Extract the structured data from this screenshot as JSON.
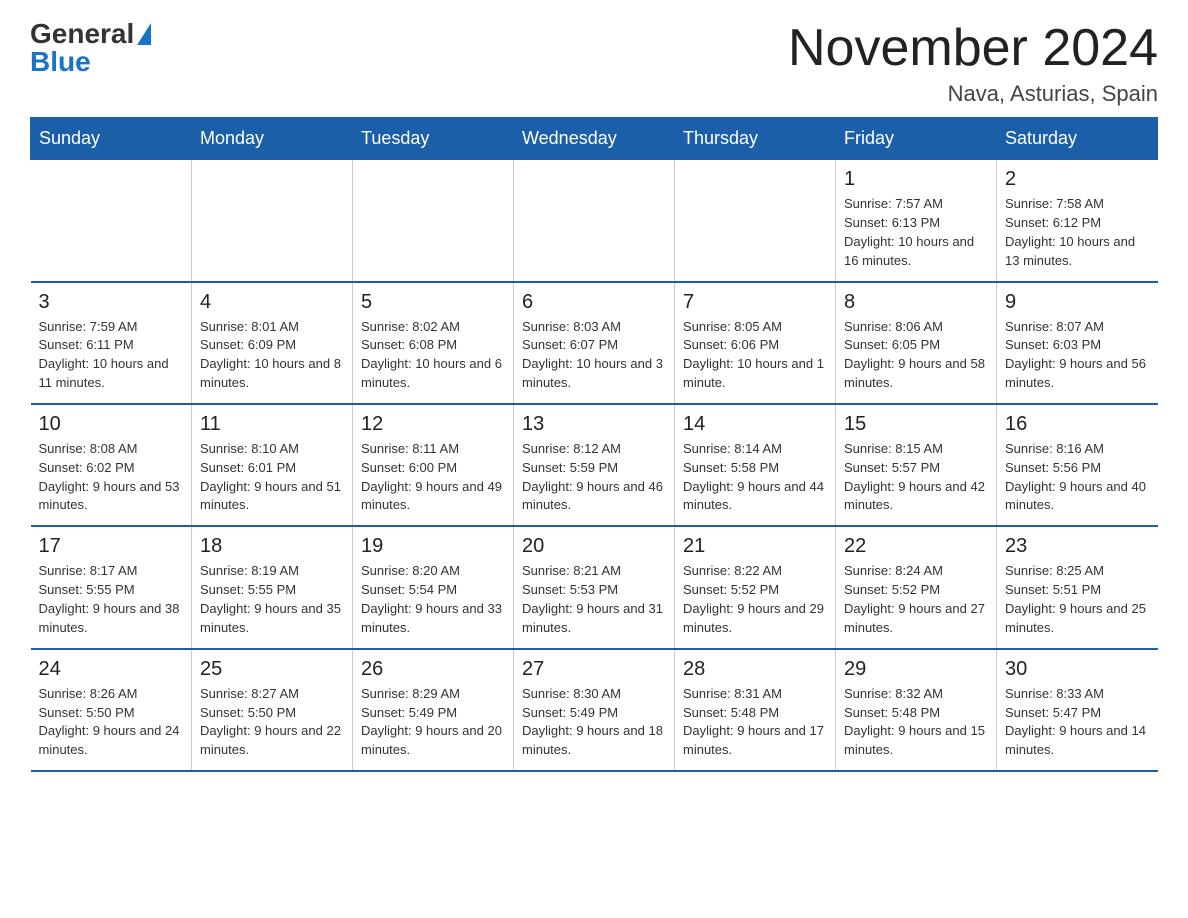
{
  "logo": {
    "general": "General",
    "blue": "Blue"
  },
  "header": {
    "title": "November 2024",
    "location": "Nava, Asturias, Spain"
  },
  "days_of_week": [
    "Sunday",
    "Monday",
    "Tuesday",
    "Wednesday",
    "Thursday",
    "Friday",
    "Saturday"
  ],
  "weeks": [
    [
      {
        "day": "",
        "info": ""
      },
      {
        "day": "",
        "info": ""
      },
      {
        "day": "",
        "info": ""
      },
      {
        "day": "",
        "info": ""
      },
      {
        "day": "",
        "info": ""
      },
      {
        "day": "1",
        "info": "Sunrise: 7:57 AM\nSunset: 6:13 PM\nDaylight: 10 hours and 16 minutes."
      },
      {
        "day": "2",
        "info": "Sunrise: 7:58 AM\nSunset: 6:12 PM\nDaylight: 10 hours and 13 minutes."
      }
    ],
    [
      {
        "day": "3",
        "info": "Sunrise: 7:59 AM\nSunset: 6:11 PM\nDaylight: 10 hours and 11 minutes."
      },
      {
        "day": "4",
        "info": "Sunrise: 8:01 AM\nSunset: 6:09 PM\nDaylight: 10 hours and 8 minutes."
      },
      {
        "day": "5",
        "info": "Sunrise: 8:02 AM\nSunset: 6:08 PM\nDaylight: 10 hours and 6 minutes."
      },
      {
        "day": "6",
        "info": "Sunrise: 8:03 AM\nSunset: 6:07 PM\nDaylight: 10 hours and 3 minutes."
      },
      {
        "day": "7",
        "info": "Sunrise: 8:05 AM\nSunset: 6:06 PM\nDaylight: 10 hours and 1 minute."
      },
      {
        "day": "8",
        "info": "Sunrise: 8:06 AM\nSunset: 6:05 PM\nDaylight: 9 hours and 58 minutes."
      },
      {
        "day": "9",
        "info": "Sunrise: 8:07 AM\nSunset: 6:03 PM\nDaylight: 9 hours and 56 minutes."
      }
    ],
    [
      {
        "day": "10",
        "info": "Sunrise: 8:08 AM\nSunset: 6:02 PM\nDaylight: 9 hours and 53 minutes."
      },
      {
        "day": "11",
        "info": "Sunrise: 8:10 AM\nSunset: 6:01 PM\nDaylight: 9 hours and 51 minutes."
      },
      {
        "day": "12",
        "info": "Sunrise: 8:11 AM\nSunset: 6:00 PM\nDaylight: 9 hours and 49 minutes."
      },
      {
        "day": "13",
        "info": "Sunrise: 8:12 AM\nSunset: 5:59 PM\nDaylight: 9 hours and 46 minutes."
      },
      {
        "day": "14",
        "info": "Sunrise: 8:14 AM\nSunset: 5:58 PM\nDaylight: 9 hours and 44 minutes."
      },
      {
        "day": "15",
        "info": "Sunrise: 8:15 AM\nSunset: 5:57 PM\nDaylight: 9 hours and 42 minutes."
      },
      {
        "day": "16",
        "info": "Sunrise: 8:16 AM\nSunset: 5:56 PM\nDaylight: 9 hours and 40 minutes."
      }
    ],
    [
      {
        "day": "17",
        "info": "Sunrise: 8:17 AM\nSunset: 5:55 PM\nDaylight: 9 hours and 38 minutes."
      },
      {
        "day": "18",
        "info": "Sunrise: 8:19 AM\nSunset: 5:55 PM\nDaylight: 9 hours and 35 minutes."
      },
      {
        "day": "19",
        "info": "Sunrise: 8:20 AM\nSunset: 5:54 PM\nDaylight: 9 hours and 33 minutes."
      },
      {
        "day": "20",
        "info": "Sunrise: 8:21 AM\nSunset: 5:53 PM\nDaylight: 9 hours and 31 minutes."
      },
      {
        "day": "21",
        "info": "Sunrise: 8:22 AM\nSunset: 5:52 PM\nDaylight: 9 hours and 29 minutes."
      },
      {
        "day": "22",
        "info": "Sunrise: 8:24 AM\nSunset: 5:52 PM\nDaylight: 9 hours and 27 minutes."
      },
      {
        "day": "23",
        "info": "Sunrise: 8:25 AM\nSunset: 5:51 PM\nDaylight: 9 hours and 25 minutes."
      }
    ],
    [
      {
        "day": "24",
        "info": "Sunrise: 8:26 AM\nSunset: 5:50 PM\nDaylight: 9 hours and 24 minutes."
      },
      {
        "day": "25",
        "info": "Sunrise: 8:27 AM\nSunset: 5:50 PM\nDaylight: 9 hours and 22 minutes."
      },
      {
        "day": "26",
        "info": "Sunrise: 8:29 AM\nSunset: 5:49 PM\nDaylight: 9 hours and 20 minutes."
      },
      {
        "day": "27",
        "info": "Sunrise: 8:30 AM\nSunset: 5:49 PM\nDaylight: 9 hours and 18 minutes."
      },
      {
        "day": "28",
        "info": "Sunrise: 8:31 AM\nSunset: 5:48 PM\nDaylight: 9 hours and 17 minutes."
      },
      {
        "day": "29",
        "info": "Sunrise: 8:32 AM\nSunset: 5:48 PM\nDaylight: 9 hours and 15 minutes."
      },
      {
        "day": "30",
        "info": "Sunrise: 8:33 AM\nSunset: 5:47 PM\nDaylight: 9 hours and 14 minutes."
      }
    ]
  ]
}
